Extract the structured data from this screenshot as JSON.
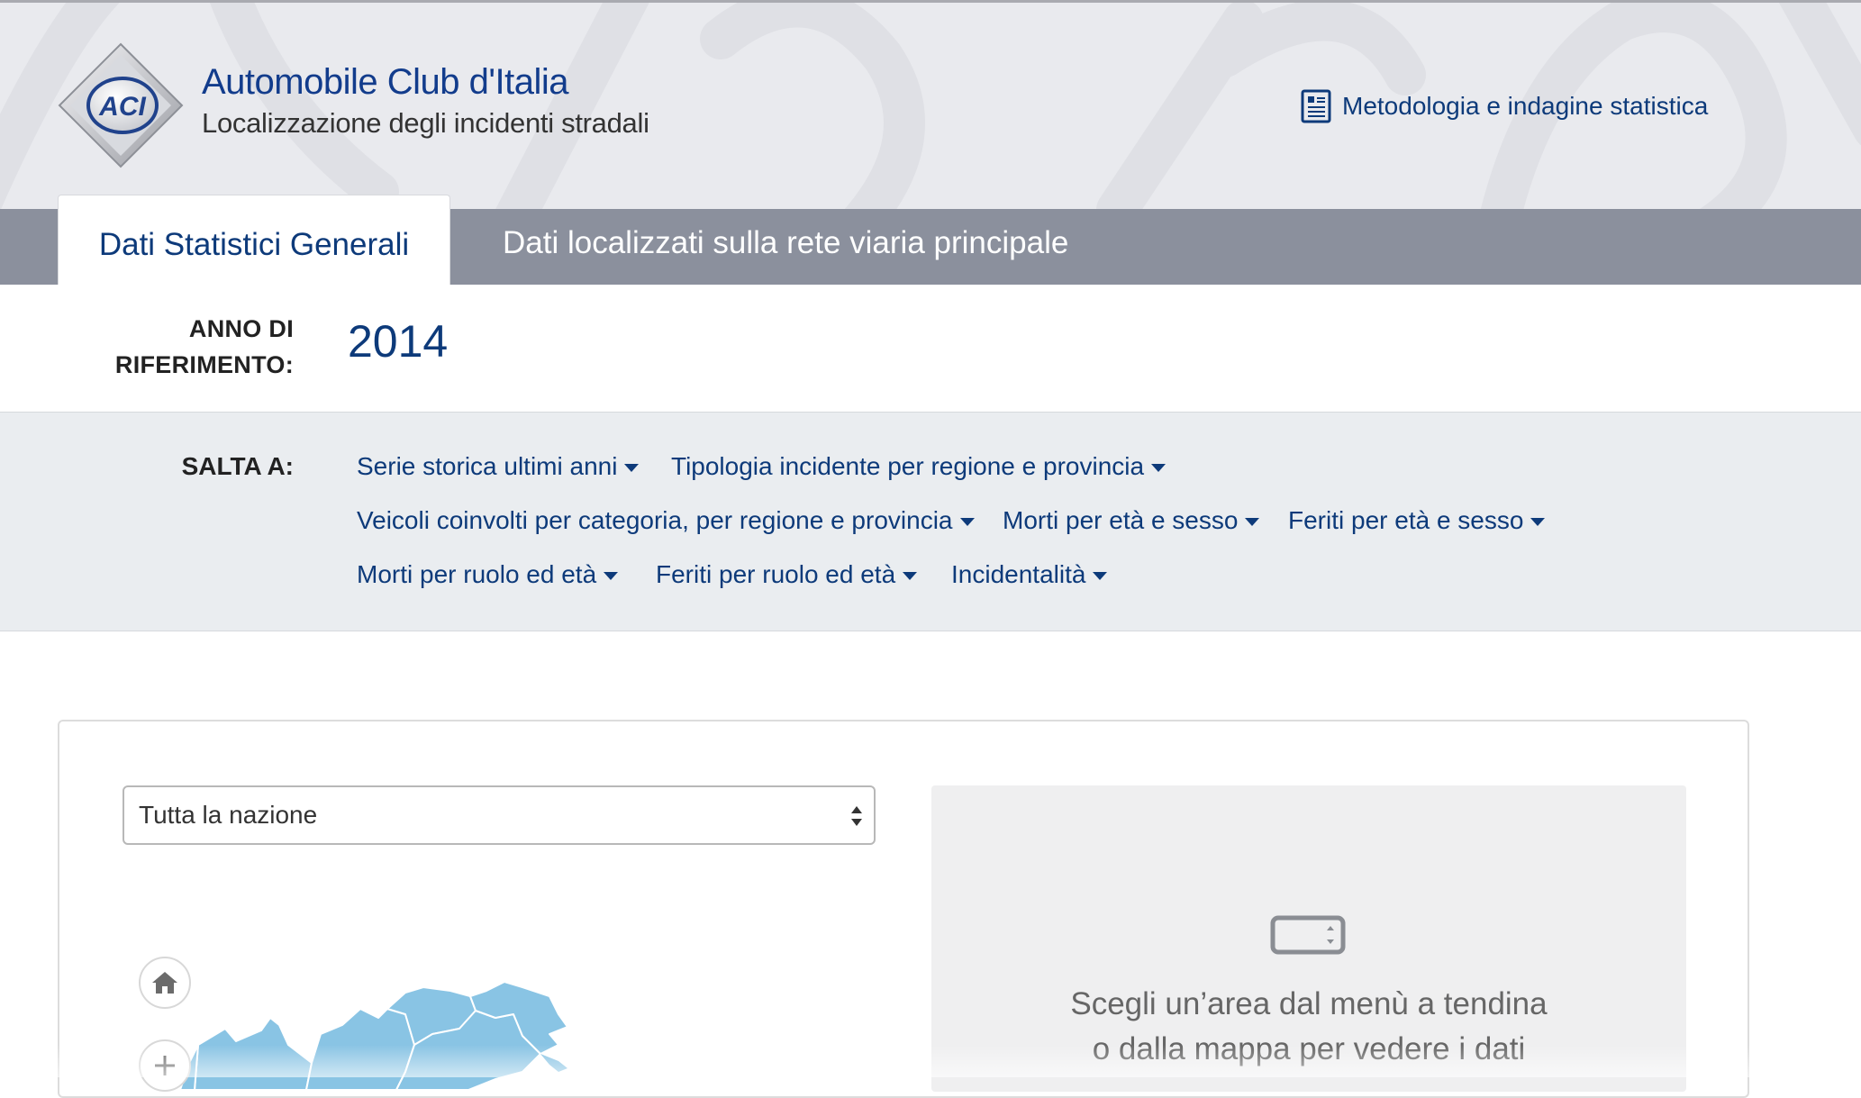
{
  "header": {
    "brand_title": "Automobile Club d'Italia",
    "brand_subtitle": "Localizzazione degli incidenti stradali",
    "logo_text": "ACI",
    "methodology_link": "Metodologia e indagine statistica"
  },
  "tabs": [
    {
      "label": "Dati Statistici Generali",
      "active": true
    },
    {
      "label": "Dati localizzati sulla rete viaria principale",
      "active": false
    }
  ],
  "reference_year": {
    "label_line1": "ANNO DI",
    "label_line2": "RIFERIMENTO:",
    "value": "2014"
  },
  "jump_to": {
    "label": "SALTA A:",
    "links": [
      "Serie storica ultimi anni",
      "Tipologia incidente per regione e provincia",
      "Veicoli coinvolti per categoria, per regione e provincia",
      "Morti per età e sesso",
      "Feriti per età e sesso",
      "Morti per ruolo ed età",
      "Feriti per ruolo ed età",
      "Incidentalità"
    ]
  },
  "area_select": {
    "selected": "Tutta la nazione"
  },
  "map_controls": {
    "home": "home-icon",
    "zoom_in": "plus-icon"
  },
  "info_box": {
    "line1": "Scegli un’area dal menù a tendina",
    "line2": "o dalla mappa per vedere i dati"
  },
  "colors": {
    "brand_blue": "#0d3a7a",
    "tab_bar": "#8b909d",
    "map_fill": "#89c4e4",
    "jump_bg": "#eaedf0"
  }
}
